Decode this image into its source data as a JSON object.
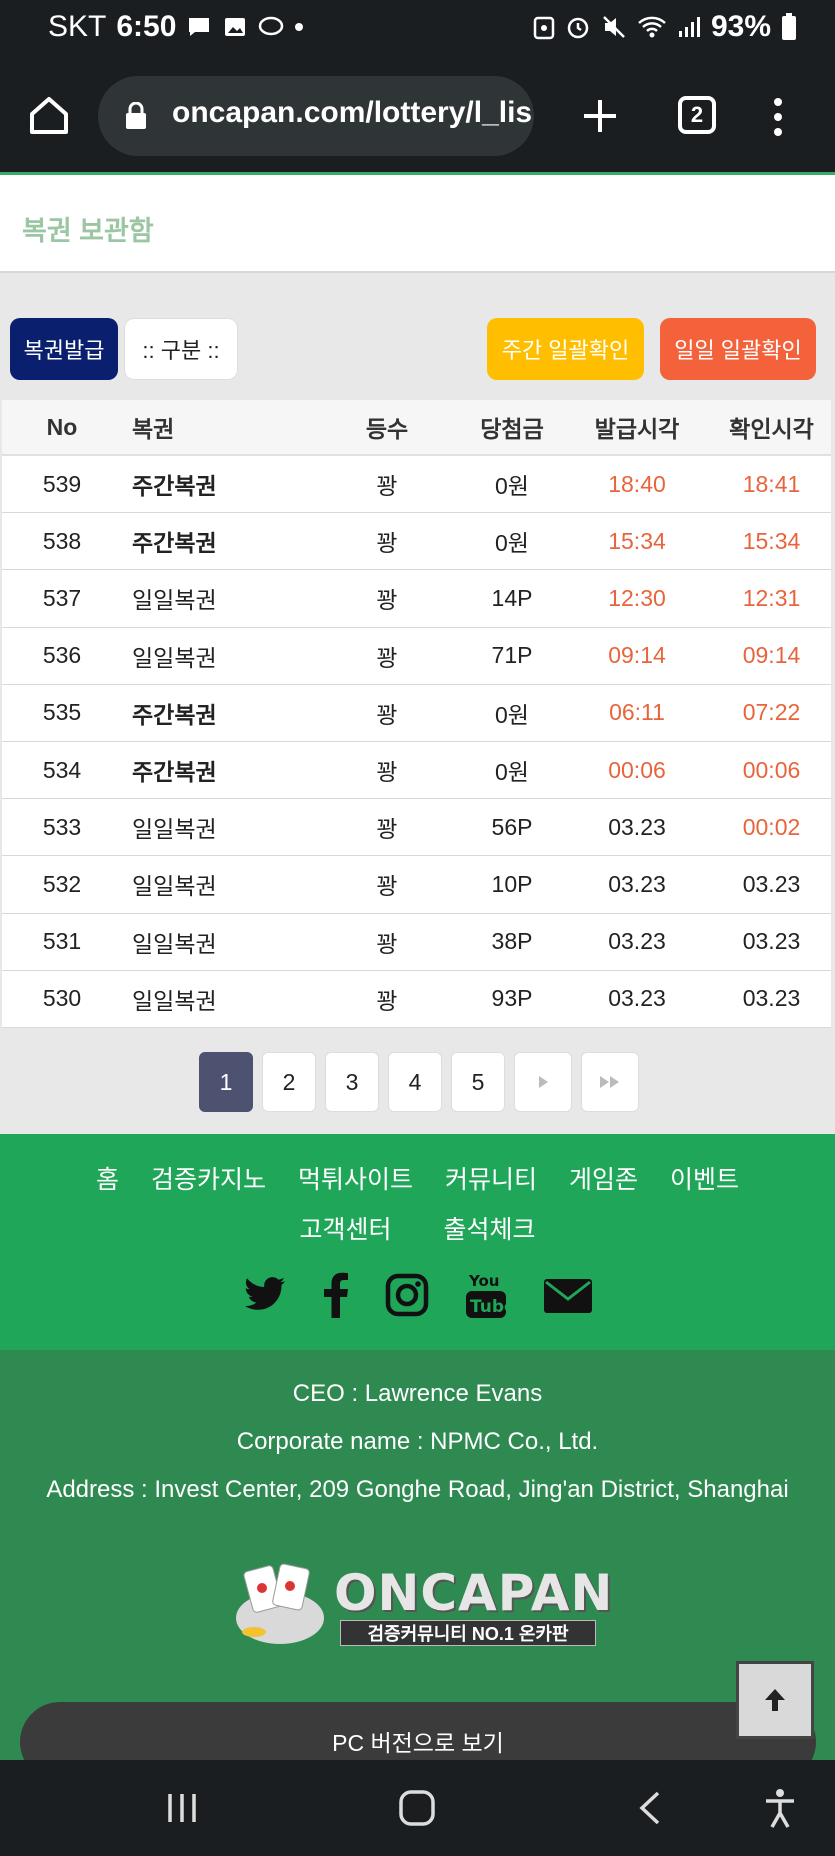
{
  "status_bar": {
    "carrier": "SKT",
    "time": "6:50",
    "battery": "93%"
  },
  "browser": {
    "url": "oncapan.com/lottery/l_lis",
    "tab_count": "2"
  },
  "page": {
    "title": "복권 보관함"
  },
  "buttons": {
    "issue": "복권발급",
    "category": ":: 구분 ::",
    "weekly_check": "주간 일괄확인",
    "daily_check": "일일 일괄확인"
  },
  "table": {
    "headers": [
      "No",
      "복권",
      "등수",
      "당첨금",
      "발급시각",
      "확인시각"
    ],
    "rows": [
      {
        "no": "539",
        "name": "주간복권",
        "rank": "꽝",
        "prize": "0원",
        "issued": "18:40",
        "checked": "18:41"
      },
      {
        "no": "538",
        "name": "주간복권",
        "rank": "꽝",
        "prize": "0원",
        "issued": "15:34",
        "checked": "15:34"
      },
      {
        "no": "537",
        "name": "일일복권",
        "rank": "꽝",
        "prize": "14P",
        "issued": "12:30",
        "checked": "12:31"
      },
      {
        "no": "536",
        "name": "일일복권",
        "rank": "꽝",
        "prize": "71P",
        "issued": "09:14",
        "checked": "09:14"
      },
      {
        "no": "535",
        "name": "주간복권",
        "rank": "꽝",
        "prize": "0원",
        "issued": "06:11",
        "checked": "07:22"
      },
      {
        "no": "534",
        "name": "주간복권",
        "rank": "꽝",
        "prize": "0원",
        "issued": "00:06",
        "checked": "00:06"
      },
      {
        "no": "533",
        "name": "일일복권",
        "rank": "꽝",
        "prize": "56P",
        "issued": "03.23",
        "checked": "00:02"
      },
      {
        "no": "532",
        "name": "일일복권",
        "rank": "꽝",
        "prize": "10P",
        "issued": "03.23",
        "checked": "03.23"
      },
      {
        "no": "531",
        "name": "일일복권",
        "rank": "꽝",
        "prize": "38P",
        "issued": "03.23",
        "checked": "03.23"
      },
      {
        "no": "530",
        "name": "일일복권",
        "rank": "꽝",
        "prize": "93P",
        "issued": "03.23",
        "checked": "03.23"
      }
    ]
  },
  "pagination": {
    "pages": [
      "1",
      "2",
      "3",
      "4",
      "5"
    ],
    "current": "1"
  },
  "footer": {
    "nav_row1": [
      "홈",
      "검증카지노",
      "먹튀사이트",
      "커뮤니티",
      "게임존",
      "이벤트"
    ],
    "nav_row2": [
      "고객센터",
      "출석체크"
    ],
    "social": [
      "twitter-icon",
      "facebook-icon",
      "instagram-icon",
      "youtube-icon",
      "email-icon"
    ],
    "ceo": "CEO : Lawrence Evans",
    "corporate": "Corporate name : NPMC Co., Ltd.",
    "address": "Address : Invest Center, 209 Gonghe Road, Jing'an District, Shanghai",
    "logo_text": "ONCAPAN",
    "logo_sub": "검증커뮤니티 NO.1 온카판",
    "pc_version": "PC 버전으로 보기"
  },
  "colors": {
    "accent_green": "#20a659",
    "issue_blue": "#0a1f6e",
    "weekly_yellow": "#ffbf00",
    "daily_orange": "#f3623b",
    "time_red": "#e8643c"
  }
}
